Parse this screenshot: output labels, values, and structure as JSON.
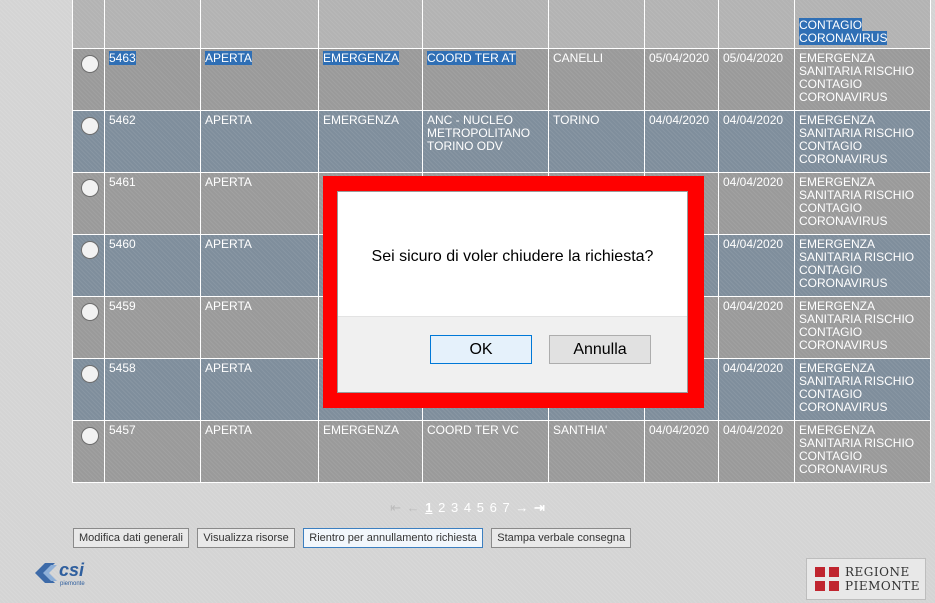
{
  "table": {
    "rows": [
      {
        "id": "",
        "stato": "",
        "tipo": "",
        "ente": "",
        "comune": "",
        "data_apertura": "",
        "data_richiesta": "",
        "descrizione": [
          "CONTAGIO",
          "CORONAVIRUS"
        ],
        "selected": true
      },
      {
        "id": "5463",
        "stato": "APERTA",
        "tipo": "EMERGENZA",
        "ente": "COORD TER AT",
        "comune": "CANELLI",
        "data_apertura": "05/04/2020",
        "data_richiesta": "05/04/2020",
        "descrizione": [
          "EMERGENZA",
          "SANITARIA RISCHIO",
          "CONTAGIO",
          "CORONAVIRUS"
        ],
        "selected": true
      },
      {
        "id": "5462",
        "stato": "APERTA",
        "tipo": "EMERGENZA",
        "ente": "ANC - NUCLEO METROPOLITANO TORINO ODV",
        "comune": "TORINO",
        "data_apertura": "04/04/2020",
        "data_richiesta": "04/04/2020",
        "descrizione": [
          "EMERGENZA",
          "SANITARIA RISCHIO",
          "CONTAGIO",
          "CORONAVIRUS"
        ],
        "selected": false
      },
      {
        "id": "5461",
        "stato": "APERTA",
        "tipo": "",
        "ente": "",
        "comune": "",
        "data_apertura": "",
        "data_richiesta": "04/04/2020",
        "descrizione": [
          "EMERGENZA",
          "SANITARIA RISCHIO",
          "CONTAGIO",
          "CORONAVIRUS"
        ],
        "selected": false
      },
      {
        "id": "5460",
        "stato": "APERTA",
        "tipo": "",
        "ente": "",
        "comune": "",
        "data_apertura": "",
        "data_richiesta": "04/04/2020",
        "descrizione": [
          "EMERGENZA",
          "SANITARIA RISCHIO",
          "CONTAGIO",
          "CORONAVIRUS"
        ],
        "selected": false
      },
      {
        "id": "5459",
        "stato": "APERTA",
        "tipo": "",
        "ente": "",
        "comune": "",
        "data_apertura": "",
        "data_richiesta": "04/04/2020",
        "descrizione": [
          "EMERGENZA",
          "SANITARIA RISCHIO",
          "CONTAGIO",
          "CORONAVIRUS"
        ],
        "selected": false
      },
      {
        "id": "5458",
        "stato": "APERTA",
        "tipo": "",
        "ente": "",
        "comune": "",
        "data_apertura": "",
        "data_richiesta": "04/04/2020",
        "descrizione": [
          "EMERGENZA",
          "SANITARIA RISCHIO",
          "CONTAGIO",
          "CORONAVIRUS"
        ],
        "selected": false
      },
      {
        "id": "5457",
        "stato": "APERTA",
        "tipo": "EMERGENZA",
        "ente": "COORD TER VC",
        "comune": "SANTHIA'",
        "data_apertura": "04/04/2020",
        "data_richiesta": "04/04/2020",
        "descrizione": [
          "EMERGENZA",
          "SANITARIA RISCHIO",
          "CONTAGIO",
          "CORONAVIRUS"
        ],
        "selected": false
      }
    ]
  },
  "pager": {
    "first": "⇤",
    "prev": "←",
    "pages": [
      "1",
      "2",
      "3",
      "4",
      "5",
      "6",
      "7"
    ],
    "current": "1",
    "next": "→",
    "last": "⇥"
  },
  "buttons": {
    "modifica": "Modifica dati generali",
    "visualizza": "Visualizza risorse",
    "rientro": "Rientro per annullamento richiesta",
    "stampa": "Stampa verbale consegna"
  },
  "footer": {
    "csi_logo_text": "csi",
    "csi_logo_sub": "piemonte",
    "regione_line1": "REGIONE",
    "regione_line2": "PIEMONTE"
  },
  "dialog": {
    "message": "Sei sicuro di voler chiudere la richiesta?",
    "ok_label": "OK",
    "cancel_label": "Annulla"
  },
  "colors": {
    "highlight_frame": "#ff0000",
    "selection": "#2f6fb5",
    "ok_border": "#0078d7",
    "table_row": "#9a9a9a",
    "table_row_alt": "#7f8e9c"
  }
}
